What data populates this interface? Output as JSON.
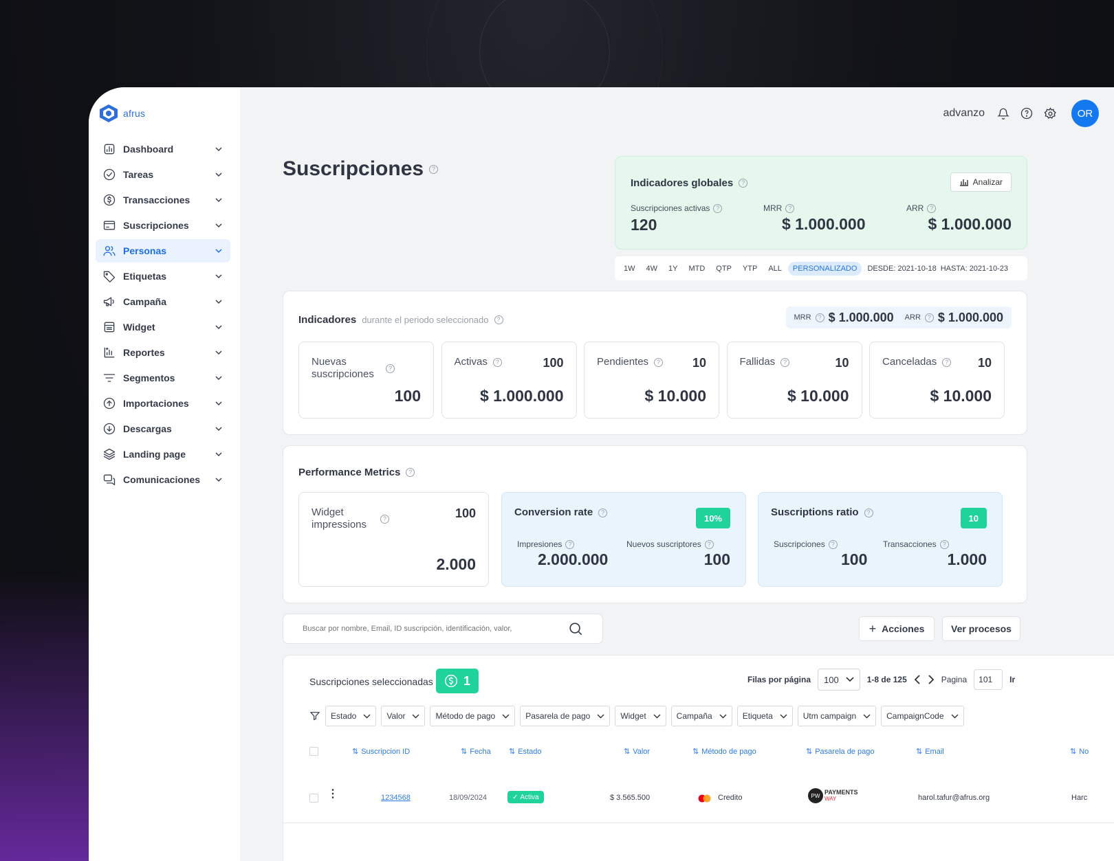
{
  "brand": {
    "name": "afrus"
  },
  "sidebar": {
    "items": [
      {
        "label": "Dashboard",
        "icon": "chart-icon",
        "active": false
      },
      {
        "label": "Tareas",
        "icon": "check-circle-icon",
        "active": false
      },
      {
        "label": "Transacciones",
        "icon": "dollar-circle-icon",
        "active": false
      },
      {
        "label": "Suscripciones",
        "icon": "card-icon",
        "active": false
      },
      {
        "label": "Personas",
        "icon": "users-icon",
        "active": true
      },
      {
        "label": "Etiquetas",
        "icon": "tag-icon",
        "active": false
      },
      {
        "label": "Campaña",
        "icon": "megaphone-icon",
        "active": false
      },
      {
        "label": "Widget",
        "icon": "widget-icon",
        "active": false
      },
      {
        "label": "Reportes",
        "icon": "report-icon",
        "active": false
      },
      {
        "label": "Segmentos",
        "icon": "filter-lines-icon",
        "active": false
      },
      {
        "label": "Importaciones",
        "icon": "upload-icon",
        "active": false
      },
      {
        "label": "Descargas",
        "icon": "download-icon",
        "active": false
      },
      {
        "label": "Landing page",
        "icon": "layers-icon",
        "active": false
      },
      {
        "label": "Comunicaciones",
        "icon": "chat-icon",
        "active": false
      }
    ]
  },
  "topbar": {
    "org": "advanzo",
    "avatar": "OR"
  },
  "page": {
    "title": "Suscripciones"
  },
  "global": {
    "title": "Indicadores globales",
    "analizar": "Analizar",
    "active_label": "Suscripciones activas",
    "active_value": "120",
    "mrr_label": "MRR",
    "mrr_value": "$ 1.000.000",
    "arr_label": "ARR",
    "arr_value": "$ 1.000.000"
  },
  "periods": [
    "1W",
    "4W",
    "1Y",
    "MTD",
    "QTP",
    "YTP",
    "ALL",
    "PERSONALIZADO"
  ],
  "period_selected": "PERSONALIZADO",
  "dates": {
    "desde": "DESDE: 2021-10-18",
    "hasta": "HASTA: 2021-10-23"
  },
  "indicadores": {
    "title": "Indicadores",
    "subtitle": "durante el periodo seleccionado",
    "mrr_label": "MRR",
    "mrr_value": "$ 1.000.000",
    "arr_label": "ARR",
    "arr_value": "$ 1.000.000",
    "cards": [
      {
        "label": "Nuevas suscripciones",
        "count": "",
        "value": "100"
      },
      {
        "label": "Activas",
        "count": "100",
        "value": "$ 1.000.000"
      },
      {
        "label": "Pendientes",
        "count": "10",
        "value": "$ 10.000"
      },
      {
        "label": "Fallidas",
        "count": "10",
        "value": "$ 10.000"
      },
      {
        "label": "Canceladas",
        "count": "10",
        "value": "$ 10.000"
      }
    ]
  },
  "performance": {
    "title": "Performance Metrics",
    "widget": {
      "label": "Widget impressions",
      "count": "100",
      "value": "2.000"
    },
    "conversion": {
      "title": "Conversion rate",
      "badge": "10%",
      "a_label": "Impresiones",
      "a_value": "2.000.000",
      "b_label": "Nuevos suscriptores",
      "b_value": "100"
    },
    "ratio": {
      "title": "Suscriptions ratio",
      "badge": "10",
      "a_label": "Suscripciones",
      "a_value": "100",
      "b_label": "Transacciones",
      "b_value": "1.000"
    }
  },
  "search": {
    "placeholder": "Buscar por nombre, Email, ID suscripción, identificación, valor,"
  },
  "actions": {
    "acciones": "Acciones",
    "procesos": "Ver procesos"
  },
  "table": {
    "selected_label": "Suscripciones seleccionadas",
    "selected_count": "1",
    "rows_label": "Filas por página",
    "rows_value": "100",
    "range": "1-8 de 125",
    "page_label": "Pagina",
    "page_value": "101",
    "go": "Ir",
    "filters": [
      "Estado",
      "Valor",
      "Método de pago",
      "Pasarela de pago",
      "Widget",
      "Campaña",
      "Etiqueta",
      "Utm campaign",
      "CampaignCode"
    ],
    "columns": [
      "Suscripcion ID",
      "Fecha",
      "Estado",
      "Valor",
      "Método de pago",
      "Pasarela de pago",
      "Email",
      "No"
    ],
    "row": {
      "id": "1234568",
      "fecha": "18/09/2024",
      "estado": "Activa",
      "valor": "$ 3.565.500",
      "metodo": "Credito",
      "pasarela_line1": "PAYMENTS",
      "pasarela_line2": "WAY",
      "email": "harol.tafur@afrus.org",
      "nombre": "Harc"
    }
  },
  "colors": {
    "accent": "#1478f0",
    "success": "#1fd39a",
    "link": "#2d7be0"
  }
}
